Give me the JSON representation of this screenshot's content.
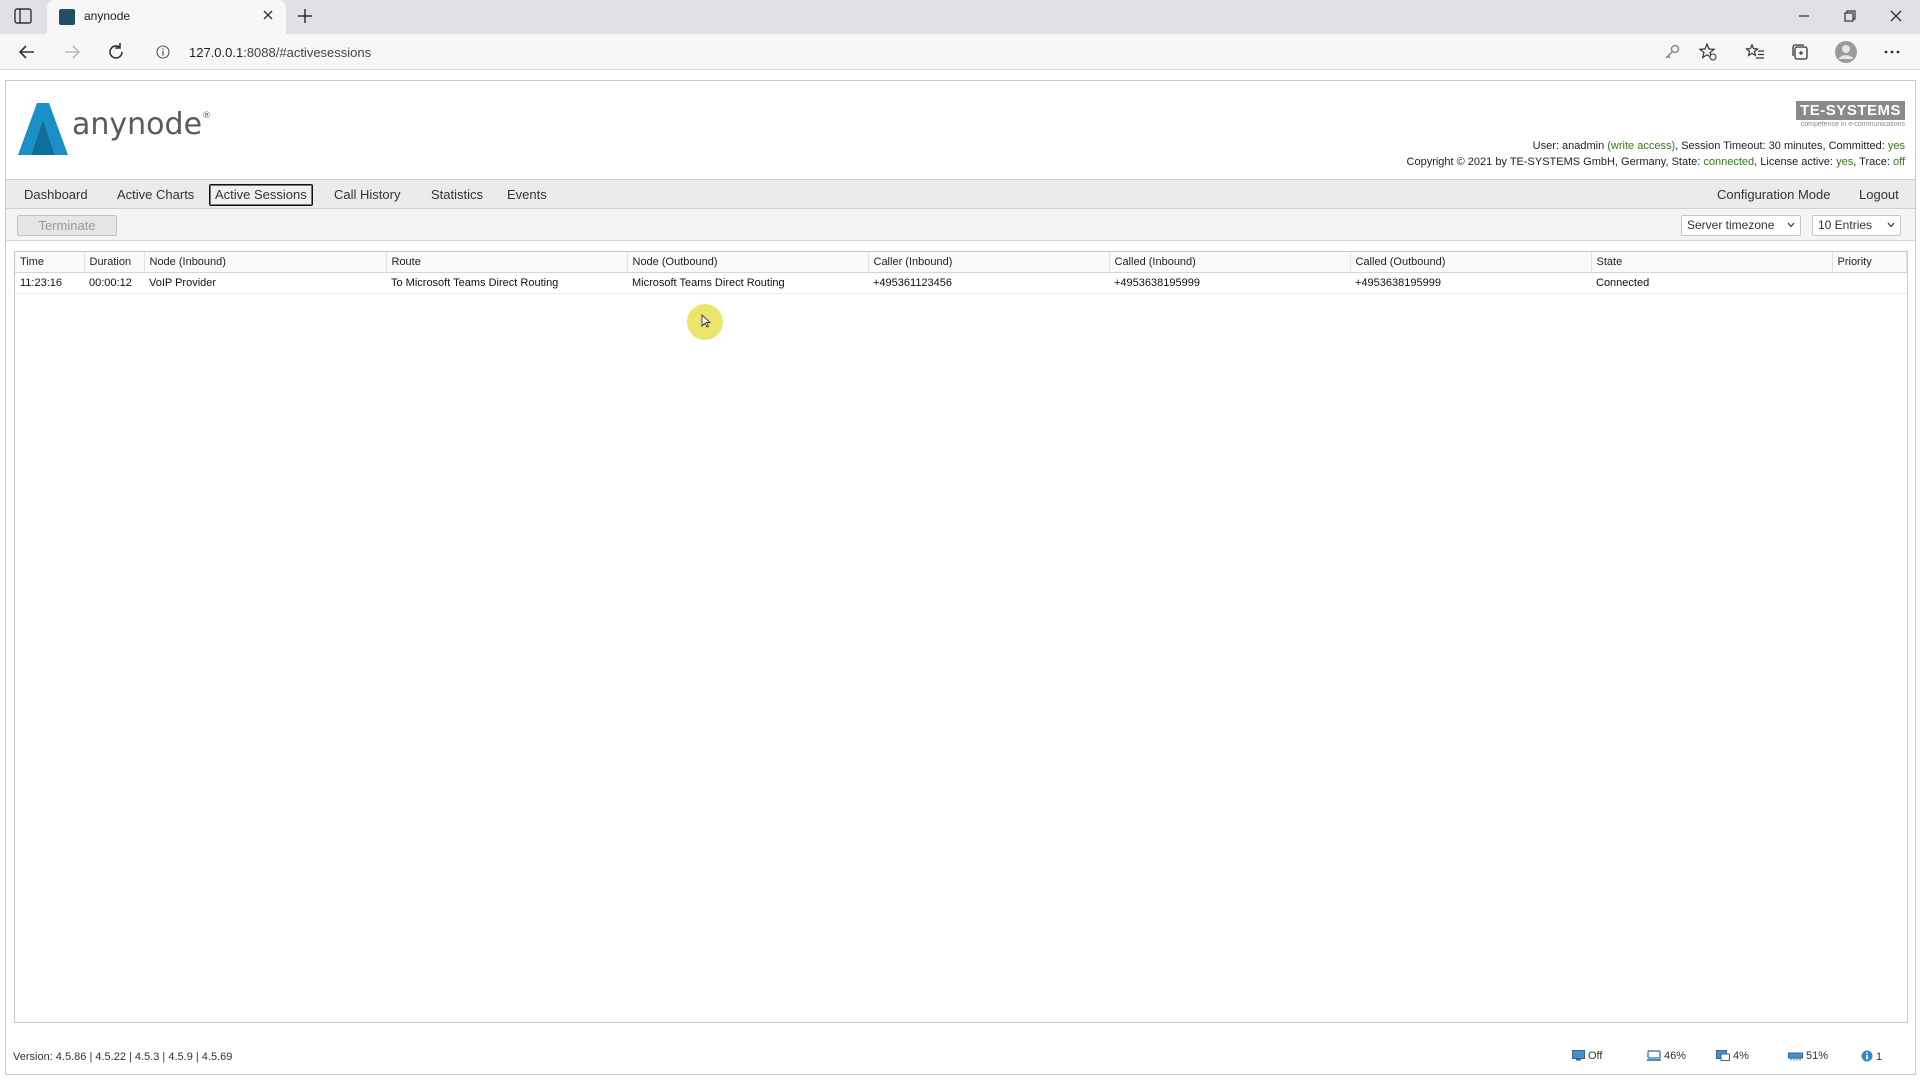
{
  "browser": {
    "tab_title": "anynode",
    "url_host": "127.0.0.1",
    "url_rest": ":8088/#activesessions"
  },
  "app": {
    "logo_name": "anynode",
    "logo_mark": "®",
    "vendor_logo": "TE-SYSTEMS",
    "vendor_tagline": "competence in e-communications",
    "info_line1": {
      "user_label": "User: ",
      "user": "anadmin",
      "access": "(write access)",
      "timeout": ", Session Timeout: 30 minutes, Committed: ",
      "committed": "yes"
    },
    "info_line2": {
      "copyright": "Copyright © 2021 by TE-SYSTEMS GmbH, Germany, State: ",
      "state": "connected",
      "license_label": ", License active: ",
      "license": "yes",
      "trace_label": ", Trace: ",
      "trace": "off"
    }
  },
  "menu": {
    "dashboard": "Dashboard",
    "active_charts": "Active Charts",
    "active_sessions": "Active Sessions",
    "call_history": "Call History",
    "statistics": "Statistics",
    "events": "Events",
    "configuration_mode": "Configuration Mode",
    "logout": "Logout"
  },
  "toolbar": {
    "terminate": "Terminate",
    "timezone": "Server timezone",
    "entries": "10 Entries"
  },
  "table": {
    "columns": [
      "Time",
      "Duration",
      "Node (Inbound)",
      "Route",
      "Node (Outbound)",
      "Caller (Inbound)",
      "Called (Inbound)",
      "Called (Outbound)",
      "State",
      "Priority"
    ],
    "rows": [
      [
        "11:23:16",
        "00:00:12",
        "VoIP Provider",
        "To Microsoft Teams Direct Routing",
        "Microsoft Teams Direct Routing",
        "+495361123456",
        "+4953638195999",
        "+4953638195999",
        "Connected",
        ""
      ]
    ]
  },
  "status": {
    "version": "Version: 4.5.86 | 4.5.22 | 4.5.3 | 4.5.9 | 4.5.69",
    "monitor": "Off",
    "cpu": "46%",
    "disk": "4%",
    "memory": "51%",
    "alerts": "1"
  }
}
